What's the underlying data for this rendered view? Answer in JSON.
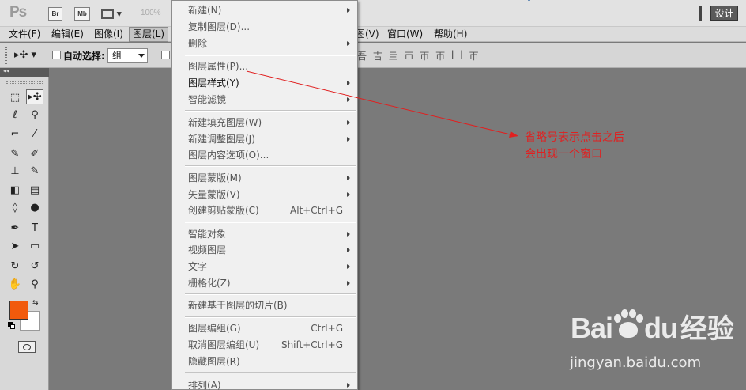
{
  "app": {
    "logo": "Ps",
    "bridge_label": "Br",
    "minibridge_label": "Mb",
    "zoom": "100%",
    "workspace_label": "设计"
  },
  "menubar": {
    "file": "文件(F)",
    "edit": "编辑(E)",
    "image": "图像(I)",
    "layer": "图层(L)",
    "view": "图(V)",
    "window": "窗口(W)",
    "help": "帮助(H)"
  },
  "options": {
    "autoselect_label": "自动选择:",
    "autoselect_value": "组"
  },
  "layer_menu": {
    "items": [
      {
        "label": "新建(N)",
        "submenu": true,
        "enabled": false
      },
      {
        "label": "复制图层(D)...",
        "enabled": false
      },
      {
        "label": "删除",
        "submenu": true,
        "enabled": false
      },
      {
        "label": "图层属性(P)...",
        "enabled": false
      },
      {
        "label": "图层样式(Y)",
        "submenu": true,
        "enabled": true
      },
      {
        "label": "智能滤镜",
        "submenu": true,
        "enabled": false
      },
      {
        "label": "新建填充图层(W)",
        "submenu": true,
        "enabled": false
      },
      {
        "label": "新建调整图层(J)",
        "submenu": true,
        "enabled": false
      },
      {
        "label": "图层内容选项(O)...",
        "enabled": false
      },
      {
        "label": "图层蒙版(M)",
        "submenu": true,
        "enabled": false
      },
      {
        "label": "矢量蒙版(V)",
        "submenu": true,
        "enabled": false
      },
      {
        "label": "创建剪贴蒙版(C)",
        "shortcut": "Alt+Ctrl+G",
        "enabled": false
      },
      {
        "label": "智能对象",
        "submenu": true,
        "enabled": false
      },
      {
        "label": "视频图层",
        "submenu": true,
        "enabled": false
      },
      {
        "label": "文字",
        "submenu": true,
        "enabled": false
      },
      {
        "label": "栅格化(Z)",
        "submenu": true,
        "enabled": false
      },
      {
        "label": "新建基于图层的切片(B)",
        "enabled": false
      },
      {
        "label": "图层编组(G)",
        "shortcut": "Ctrl+G",
        "enabled": false
      },
      {
        "label": "取消图层编组(U)",
        "shortcut": "Shift+Ctrl+G",
        "enabled": false
      },
      {
        "label": "隐藏图层(R)",
        "enabled": false
      },
      {
        "label": "排列(A)",
        "submenu": true,
        "enabled": false
      }
    ]
  },
  "annotation": {
    "line1": "省略号表示点击之后",
    "line2": "会出现一个窗口",
    "color": "#e02020"
  },
  "colors": {
    "foreground": "#f15a0c",
    "background": "#ffffff"
  },
  "watermark": {
    "brand": "Bai",
    "brand_suffix": "du",
    "product": "经验",
    "url": "jingyan.baidu.com"
  }
}
